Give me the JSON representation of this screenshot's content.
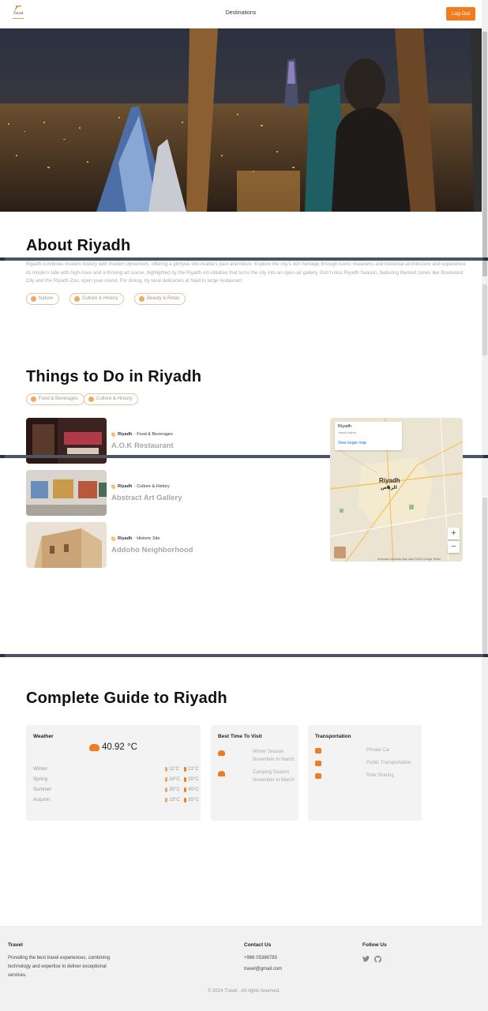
{
  "header": {
    "logo_text": "Travel",
    "nav_label": "Destinations",
    "logout_label": "Log Out"
  },
  "about": {
    "title": "About Riyadh",
    "text": "Riyadh combines modern history with modern dynamism, offering a glimpse into Arabia's past and future. Explore the city's rich heritage through iconic museums and historical architecture and experience its modern side with high-rises and a thriving art scene, highlighted by the Riyadh Art initiative that turns the city into an open-air gallery. Don't miss Riyadh Season, featuring themed zones like Boulevard City and the Riyadh Zoo, open year-round. For dining, try local delicacies at Najd to large restaurant.",
    "tags": [
      "Nature",
      "Culture & History",
      "Beauty & Relax"
    ]
  },
  "things": {
    "title": "Things to Do in Riyadh",
    "filters": [
      "Food & Beverages",
      "Culture & History"
    ],
    "places": [
      {
        "city": "Riyadh",
        "category": "Food & Beverages",
        "name": "A.O.K Restaurant"
      },
      {
        "city": "Riyadh",
        "category": "Culture & History",
        "name": "Abstract Art Gallery"
      },
      {
        "city": "Riyadh",
        "category": "Historic Site",
        "name": "Addoho Neighborhood"
      }
    ]
  },
  "map": {
    "info_title": "Riyadh",
    "info_sub": "Saudi Arabia",
    "info_link": "View larger map",
    "city_label": "Riyadh",
    "city_label_ar": "الرياض",
    "zoom_in": "+",
    "zoom_out": "−",
    "footer": "Keyboard shortcuts  Map data ©2024 Google  Terms"
  },
  "guide": {
    "title": "Complete Guide to Riyadh",
    "weather": {
      "title": "Weather",
      "current_temp": "40.92 °C",
      "seasons": [
        {
          "name": "Winter",
          "low": "11°C",
          "high": "21°C"
        },
        {
          "name": "Spring",
          "low": "24°C",
          "high": "35°C"
        },
        {
          "name": "Summer",
          "low": "35°C",
          "high": "45°C"
        },
        {
          "name": "Autumn",
          "low": "15°C",
          "high": "35°C"
        }
      ]
    },
    "best_time": {
      "title": "Best Time To Visit",
      "items": [
        {
          "label": "Winter Season",
          "range": "November to March"
        },
        {
          "label": "Camping Season",
          "range": "November to March"
        }
      ]
    },
    "transportation": {
      "title": "Transportation",
      "items": [
        "Private Car",
        "Public Transportation",
        "Ride Sharing"
      ]
    }
  },
  "footer": {
    "brand": "Travel",
    "tagline": "Providing the best travel experiences, combining technology and expertise to deliver exceptional services.",
    "contact_title": "Contact Us",
    "phone": "+966 05386783",
    "email": "travel@gmail.com",
    "follow_title": "Follow Us",
    "copyright": "© 2024 Travel . All rights reserved."
  },
  "colors": {
    "accent": "#f07c22",
    "card_bg": "#f3f3f3",
    "footer_bg": "#f1f1f1"
  }
}
